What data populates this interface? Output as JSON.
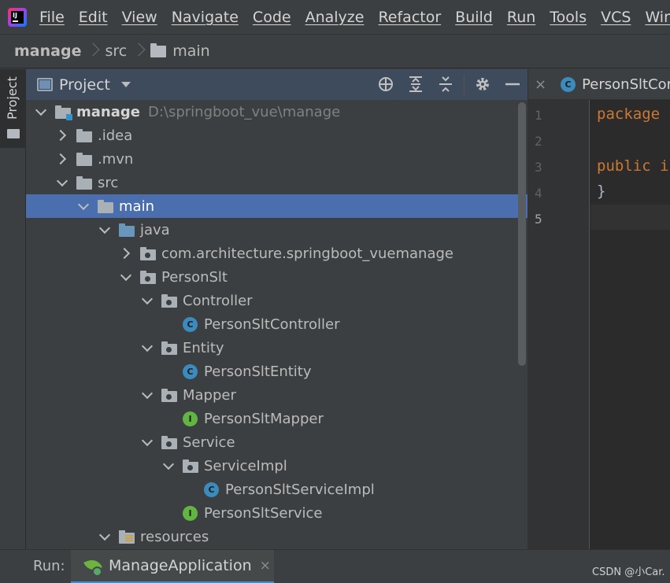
{
  "menu": {
    "app_icon": "intellij-idea-icon",
    "items": [
      "File",
      "Edit",
      "View",
      "Navigate",
      "Code",
      "Analyze",
      "Refactor",
      "Build",
      "Run",
      "Tools",
      "VCS",
      "Window"
    ]
  },
  "breadcrumb": {
    "items": [
      "manage",
      "src",
      "main"
    ]
  },
  "toolstrip": {
    "project_tab": "Project"
  },
  "project_panel": {
    "title": "Project",
    "tools": [
      "locate-icon",
      "expand-all-icon",
      "collapse-all-icon",
      "gear-icon",
      "minimize-icon"
    ],
    "tree": [
      {
        "label": "manage",
        "path": "D:\\springboot_vue\\manage",
        "icon": "module-folder-icon",
        "expanded": true
      },
      {
        "label": ".idea",
        "icon": "folder-icon",
        "expanded": false
      },
      {
        "label": ".mvn",
        "icon": "folder-icon",
        "expanded": false
      },
      {
        "label": "src",
        "icon": "folder-icon",
        "expanded": true
      },
      {
        "label": "main",
        "icon": "folder-icon",
        "expanded": true,
        "selected": true
      },
      {
        "label": "java",
        "icon": "source-folder-icon",
        "expanded": true
      },
      {
        "label": "com.architecture.springboot_vuemanage",
        "icon": "package-icon",
        "expanded": false
      },
      {
        "label": "PersonSlt",
        "icon": "package-icon",
        "expanded": true
      },
      {
        "label": "Controller",
        "icon": "package-icon",
        "expanded": true
      },
      {
        "label": "PersonSltController",
        "icon": "class-icon"
      },
      {
        "label": "Entity",
        "icon": "package-icon",
        "expanded": true
      },
      {
        "label": "PersonSltEntity",
        "icon": "class-icon"
      },
      {
        "label": "Mapper",
        "icon": "package-icon",
        "expanded": true
      },
      {
        "label": "PersonSltMapper",
        "icon": "interface-icon"
      },
      {
        "label": "Service",
        "icon": "package-icon",
        "expanded": true
      },
      {
        "label": "ServiceImpl",
        "icon": "package-icon",
        "expanded": true
      },
      {
        "label": "PersonSltServiceImpl",
        "icon": "class-icon"
      },
      {
        "label": "PersonSltService",
        "icon": "interface-icon"
      },
      {
        "label": "resources",
        "icon": "resources-folder-icon",
        "expanded": true
      }
    ]
  },
  "editor": {
    "tab_close": "×",
    "tab_title": "PersonSltCor",
    "class_badge": "C",
    "interface_badge": "I",
    "line_numbers": [
      "1",
      "2",
      "3",
      "4",
      "5"
    ],
    "code": {
      "line1": "package",
      "line3": "public i",
      "line4": "}"
    }
  },
  "run_bar": {
    "label": "Run:",
    "tab_title": "ManageApplication",
    "tab_close": "×"
  },
  "watermark": "CSDN @小Car."
}
